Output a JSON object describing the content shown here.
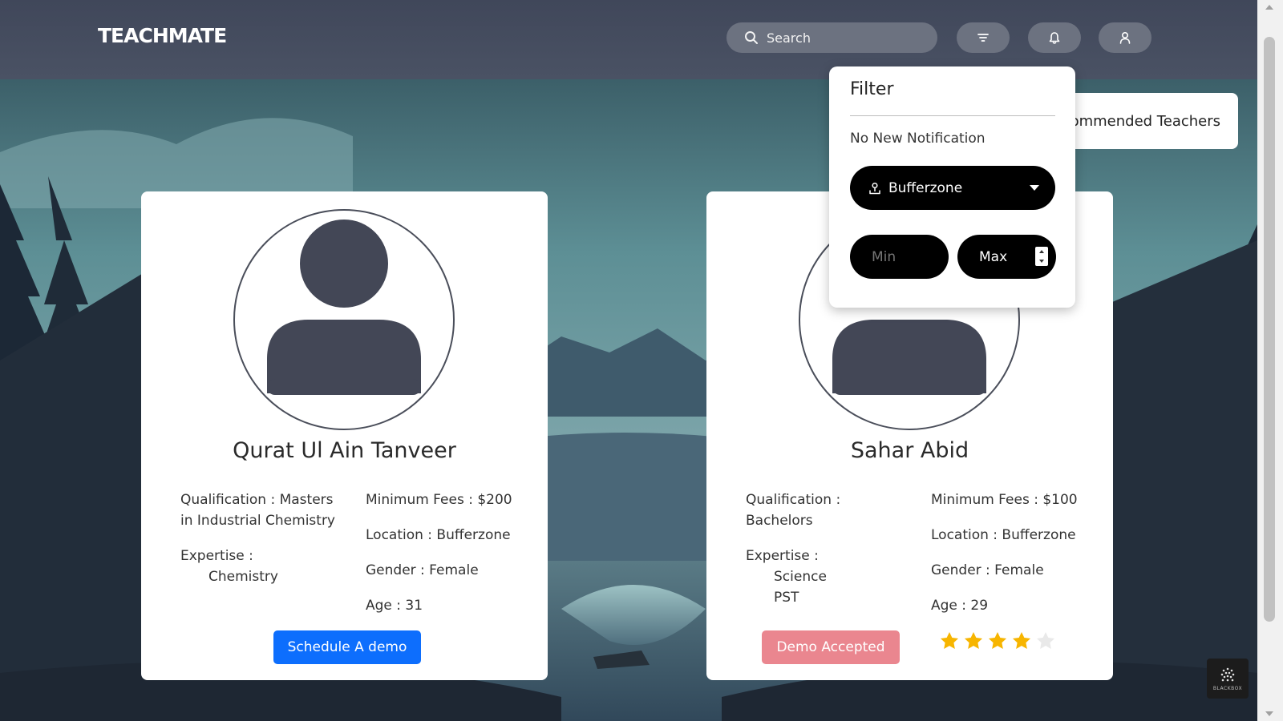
{
  "header": {
    "logo": "TEACHMATE",
    "search_placeholder": "Search",
    "filter_icon": "filter-icon",
    "bell_icon": "bell-icon",
    "user_icon": "user-icon"
  },
  "recommended_label": "Recommended Teachers",
  "filter_popup": {
    "title": "Filter",
    "notification": "No New Notification",
    "location_value": "Bufferzone",
    "min_placeholder": "Min",
    "max_placeholder": "Max"
  },
  "teachers": [
    {
      "name": "Qurat Ul Ain Tanveer",
      "qualification_label": "Qualification :",
      "qualification": "Masters in Industrial Chemistry",
      "expertise_label": "Expertise :",
      "expertise": [
        "Chemistry"
      ],
      "min_fees": "Minimum Fees : $200",
      "location": "Location : Bufferzone",
      "gender": "Gender : Female",
      "age": "Age : 31",
      "action_label": "Schedule A demo"
    },
    {
      "name": "Sahar Abid",
      "qualification_label": "Qualification :",
      "qualification": "Bachelors",
      "expertise_label": "Expertise :",
      "expertise": [
        "Science",
        "PST"
      ],
      "min_fees": "Minimum Fees : $100",
      "location": "Location : Bufferzone",
      "gender": "Gender : Female",
      "age": "Age : 29",
      "action_label": "Demo Accepted",
      "rating": 4,
      "rating_max": 5
    }
  ],
  "widget_label": "BLACKBOX",
  "colors": {
    "primary_button": "#0d6efd",
    "accepted_button": "#ea868f",
    "star_filled": "#f7b500",
    "star_empty": "#e9e9e9",
    "avatar": "#434756"
  }
}
